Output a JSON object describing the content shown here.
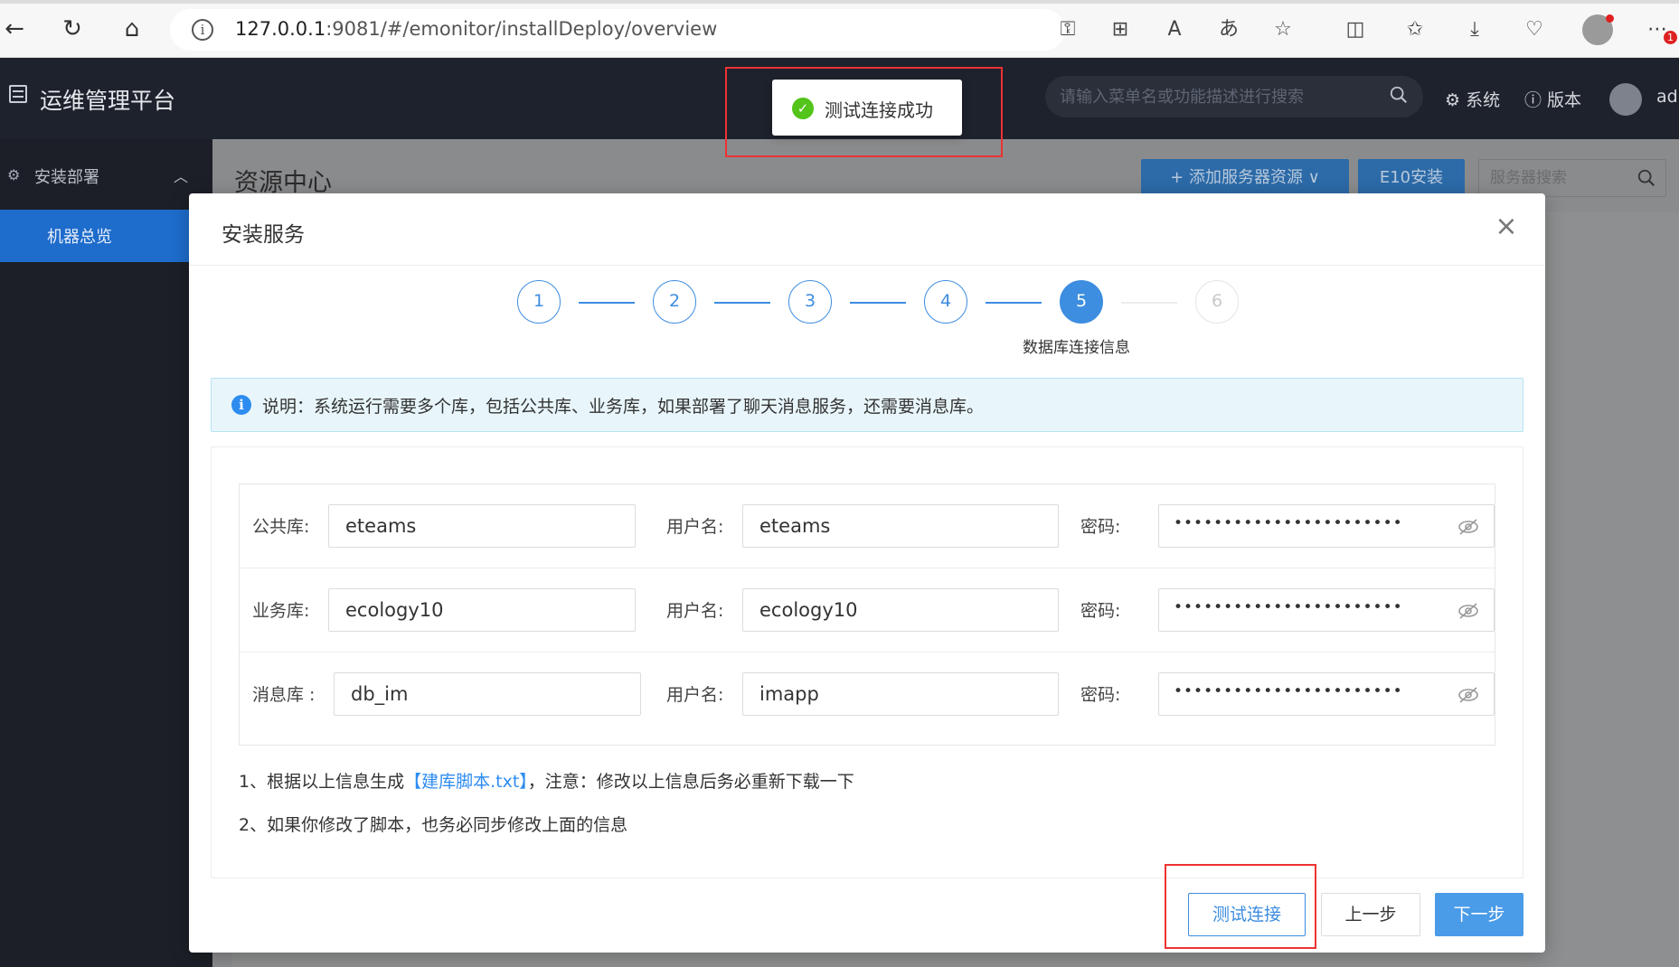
{
  "browser": {
    "url_host": "127.0.0.1",
    "url_rest": ":9081/#/emonitor/installDeploy/overview",
    "notification_count": "1"
  },
  "header": {
    "app_title": "运维管理平台",
    "search_placeholder": "请输入菜单名或功能描述进行搜索",
    "system_label": "系统",
    "version_label": "版本",
    "user_name": "adr"
  },
  "toast": {
    "text": "测试连接成功"
  },
  "sidebar": {
    "group_label": "安装部署",
    "items": [
      {
        "label": "机器总览"
      }
    ]
  },
  "page": {
    "title": "资源中心",
    "add_server_label": "+ 添加服务器资源 ∨",
    "e10_install_label": "E10安装",
    "server_search_placeholder": "服务器搜索"
  },
  "modal": {
    "title": "安装服务",
    "steps": [
      "1",
      "2",
      "3",
      "4",
      "5",
      "6"
    ],
    "active_step_label": "数据库连接信息",
    "notice": "说明：系统运行需要多个库，包括公共库、业务库，如果部署了聊天消息服务，还需要消息库。",
    "rows": [
      {
        "db_label": "公共库:",
        "db_value": "eteams",
        "user_label": "用户名:",
        "user_value": "eteams",
        "pwd_label": "密码:",
        "pwd_value": "•••••••••••••••••••••••"
      },
      {
        "db_label": "业务库:",
        "db_value": "ecology10",
        "user_label": "用户名:",
        "user_value": "ecology10",
        "pwd_label": "密码:",
        "pwd_value": "•••••••••••••••••••••••"
      },
      {
        "db_label": "消息库 :",
        "db_value": "db_im",
        "user_label": "用户名:",
        "user_value": "imapp",
        "pwd_label": "密码:",
        "pwd_value": "•••••••••••••••••••••••"
      }
    ],
    "note1_prefix": "1、根据以上信息生成",
    "note1_link": "【建库脚本.txt】",
    "note1_suffix": "，注意：修改以上信息后务必重新下载一下",
    "note2": "2、如果你修改了脚本，也务必同步修改上面的信息",
    "test_label": "测试连接",
    "prev_label": "上一步",
    "next_label": "下一步"
  }
}
